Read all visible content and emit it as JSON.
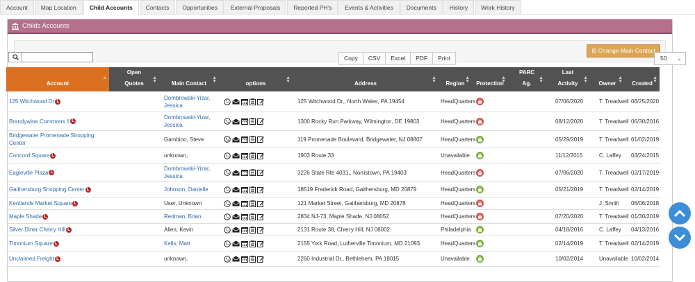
{
  "tabs": [
    "Account",
    "Map Location",
    "Child Accounts",
    "Contacts",
    "Opportunities",
    "External Proposals",
    "Reported PH's",
    "Events & Activities",
    "Documents",
    "History",
    "Work History"
  ],
  "active_tab": 2,
  "panel": {
    "title": "Childs Accounts"
  },
  "toolbar": {
    "change_contact": "Change Main Contact"
  },
  "search": {
    "value": "",
    "placeholder": ""
  },
  "export_buttons": [
    "Copy",
    "CSV",
    "Excel",
    "PDF",
    "Print"
  ],
  "page_size": "50",
  "columns": {
    "account": "Account",
    "open_quotes_1": "Open",
    "open_quotes_2": "Quotes",
    "main_contact": "Main Contact",
    "options": "options",
    "address": "Address",
    "region": "Region",
    "protection": "Protection",
    "parc_1": "PARC",
    "parc_2": "Ag.",
    "last_activity_1": "Last",
    "last_activity_2": "Activity",
    "owner": "Owner",
    "created": "Created"
  },
  "badge_letter": "L",
  "protection_colors": {
    "red": "#d9534f",
    "green": "#7cb342"
  },
  "rows": [
    {
      "account": "125 Witchwood Dr",
      "contact": "Dombrowski-Yizar, Jessica",
      "contact_link": true,
      "address": "125 Witchwood Dr,, North Wales, PA 19454",
      "region": "HeadQuarters",
      "protection": "red",
      "last_activity": "07/06/2020",
      "owner": "T. Treadwell",
      "created": "06/25/2020"
    },
    {
      "account": "Brandywine Commons II",
      "contact": "Dombrowski-Yizar, Jessica",
      "contact_link": true,
      "address": "1300 Rocky Run Parkway, Wilmington, DE 19803",
      "region": "HeadQuarters",
      "protection": "red",
      "last_activity": "08/12/2020",
      "owner": "T. Treadwell",
      "created": "06/30/2016"
    },
    {
      "account": "Bridgewater Promenade Shopping Center",
      "contact": "Gambino, Steve",
      "contact_link": false,
      "address": "119 Promenade Boulevard, Bridgewater, NJ 08807",
      "region": "HeadQuarters",
      "protection": "green",
      "last_activity": "05/29/2019",
      "owner": "T. Treadwell",
      "created": "01/02/2019"
    },
    {
      "account": "Concord Square",
      "contact": "unknown,",
      "contact_link": false,
      "address": "1903 Route 33",
      "region": "Unavailable",
      "protection": "green",
      "last_activity": "11/12/2015",
      "owner": "C. Laffey",
      "created": "03/24/2015"
    },
    {
      "account": "Eagleville Plaza",
      "contact": "Dombrowski-Yizar, Jessica",
      "contact_link": true,
      "address": "3226 State Rte 4031,, Norristown, PA 19403",
      "region": "HeadQuarters",
      "protection": "red",
      "last_activity": "07/06/2020",
      "owner": "T. Treadwell",
      "created": "02/17/2019"
    },
    {
      "account": "Gaithersburg Shopping Center",
      "contact": "Johnson, Danielle",
      "contact_link": true,
      "address": "18519 Frederick Road, Gaithersburg, MD 20879",
      "region": "HeadQuarters",
      "protection": "green",
      "last_activity": "05/21/2019",
      "owner": "T. Treadwell",
      "created": "02/14/2019"
    },
    {
      "account": "Kentlands Market Square",
      "contact": "User, Unknown",
      "contact_link": false,
      "address": "121 Market Street, Gaithersburg, MD 20878",
      "region": "HeadQuarters",
      "protection": "red",
      "last_activity": "",
      "owner": "J. Smith",
      "created": "06/06/2018"
    },
    {
      "account": "Maple Shade",
      "contact": "Redman, Brian",
      "contact_link": true,
      "address": "2834 NJ-73, Maple Shade, NJ 08052",
      "region": "HeadQuarters",
      "protection": "red",
      "last_activity": "07/20/2020",
      "owner": "T. Treadwell",
      "created": "01/30/2019"
    },
    {
      "account": "Silver Diner Cherry Hill",
      "contact": "Allen, Kevin",
      "contact_link": false,
      "address": "2131 Route 38, Cherry Hill, NJ 08002",
      "region": "Philadelphia",
      "protection": "green",
      "last_activity": "04/18/2016",
      "owner": "C. Laffey",
      "created": "04/13/2016"
    },
    {
      "account": "Timonium Square",
      "contact": "Kells, Matt",
      "contact_link": true,
      "address": "2155 York Road, Lutherville Timonium, MD 21093",
      "region": "HeadQuarters",
      "protection": "green",
      "last_activity": "02/14/2019",
      "owner": "T. Treadwell",
      "created": "02/14/2019"
    },
    {
      "account": "Unclaimed Freight",
      "contact": "unknown,",
      "contact_link": false,
      "address": "2260 Industrial Dr., Bethlehem, PA 18015",
      "region": "Unavailable",
      "protection": "green",
      "last_activity": "10/02/2014",
      "owner": "Unavailable",
      "created": "10/02/2014"
    }
  ]
}
